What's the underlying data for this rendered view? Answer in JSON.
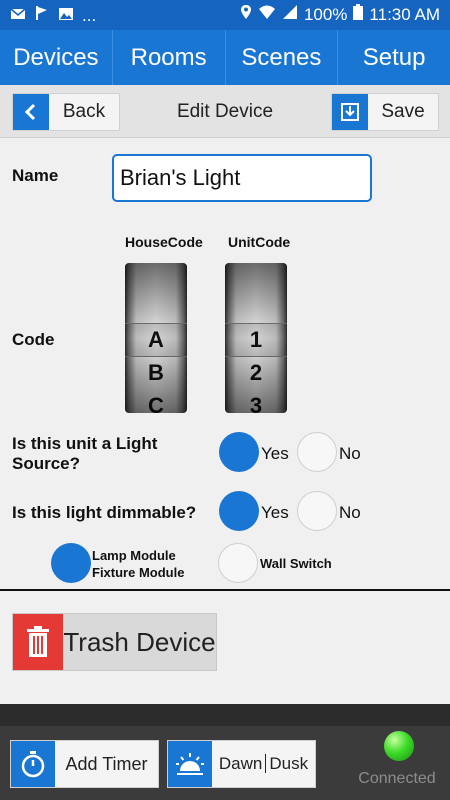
{
  "status_bar": {
    "left_icons": [
      "mail-icon",
      "flag-icon",
      "image-icon"
    ],
    "more_indicator": "...",
    "battery": "100%",
    "time": "11:30 AM"
  },
  "nav": {
    "tabs": [
      "Devices",
      "Rooms",
      "Scenes",
      "Setup"
    ]
  },
  "header": {
    "back_label": "Back",
    "title": "Edit Device",
    "save_label": "Save"
  },
  "form": {
    "name_label": "Name",
    "name_value": "Brian's Light",
    "code_label": "Code",
    "housecode_label": "HouseCode",
    "unitcode_label": "UnitCode",
    "housecode_wheel": [
      "A",
      "B",
      "C"
    ],
    "unitcode_wheel": [
      "1",
      "2",
      "3"
    ],
    "housecode_selected": "A",
    "unitcode_selected": "1",
    "light_source_question": "Is this unit a Light Source?",
    "light_source_value": "Yes",
    "dimmable_question": "Is this light dimmable?",
    "dimmable_value": "Yes",
    "yes_label": "Yes",
    "no_label": "No",
    "module_option_1": "Lamp Module",
    "module_option_1b": "Fixture Module",
    "module_option_2": "Wall Switch",
    "module_value": "Lamp Module / Fixture Module"
  },
  "actions": {
    "trash_label": "Trash Device"
  },
  "footer": {
    "add_timer_label": "Add Timer",
    "dawn_label": "Dawn",
    "dusk_label": "Dusk",
    "connection_status": "Connected",
    "connection_color": "#3ddc2a"
  },
  "colors": {
    "primary": "#1976d2",
    "status_bar": "#1565c0",
    "trash": "#e53935"
  }
}
